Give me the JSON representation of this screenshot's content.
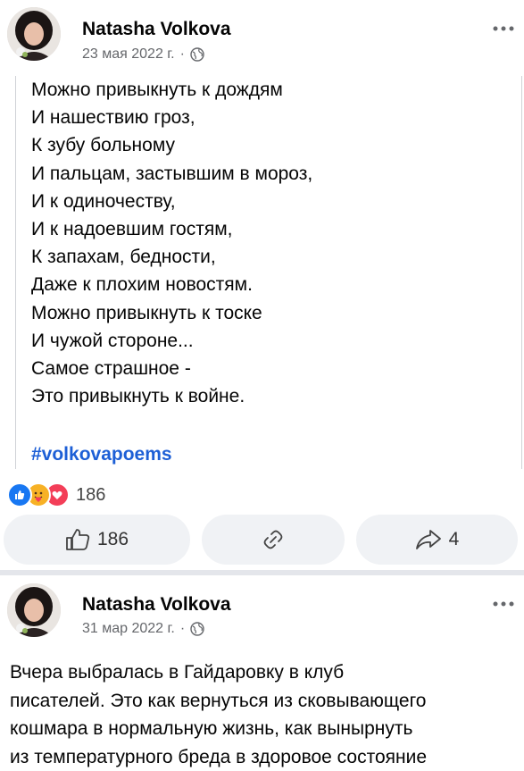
{
  "posts": [
    {
      "author": "Natasha Volkova",
      "date": "23 мая 2022 г.",
      "separator": "·",
      "poem_lines": [
        "Можно привыкнуть к дождям",
        "И нашествию гроз,",
        "К зубу больному",
        "И пальцам, застывшим в мороз,",
        "И к одиночеству,",
        "И к надоевшим гостям,",
        "К запахам, бедности,",
        "Даже к плохим новостям.",
        "Можно привыкнуть к тоске",
        "И чужой стороне...",
        "Самое страшное -",
        "Это привыкнуть к войне."
      ],
      "hashtag": "#volkovapoems",
      "reactions_count": "186",
      "like_count": "186",
      "share_count": "4"
    },
    {
      "author": "Natasha Volkova",
      "date": "31 мар 2022 г.",
      "separator": "·",
      "text_lines": [
        "Вчера выбралась в Гайдаровку в клуб",
        "писателей. Это как вернуться из сковывающего",
        "кошмара в нормальную жизнь, как вынырнуть",
        "из температурного бреда в здоровое состояние"
      ]
    }
  ],
  "icons": {
    "more": "more-horizontal-icon",
    "globe": "globe-icon",
    "like": "thumbs-up-icon",
    "comment": "link-icon",
    "share": "share-arrow-icon",
    "reaction_like": "like-reaction-icon",
    "reaction_care": "care-reaction-icon",
    "reaction_love": "love-reaction-icon"
  },
  "colors": {
    "hashtag": "#1d5fd6",
    "like_blue": "#1877f2",
    "love_red": "#f33e58",
    "care_yellow": "#f7b125",
    "pill_bg": "#f0f2f5",
    "separator": "#e4e6eb"
  }
}
